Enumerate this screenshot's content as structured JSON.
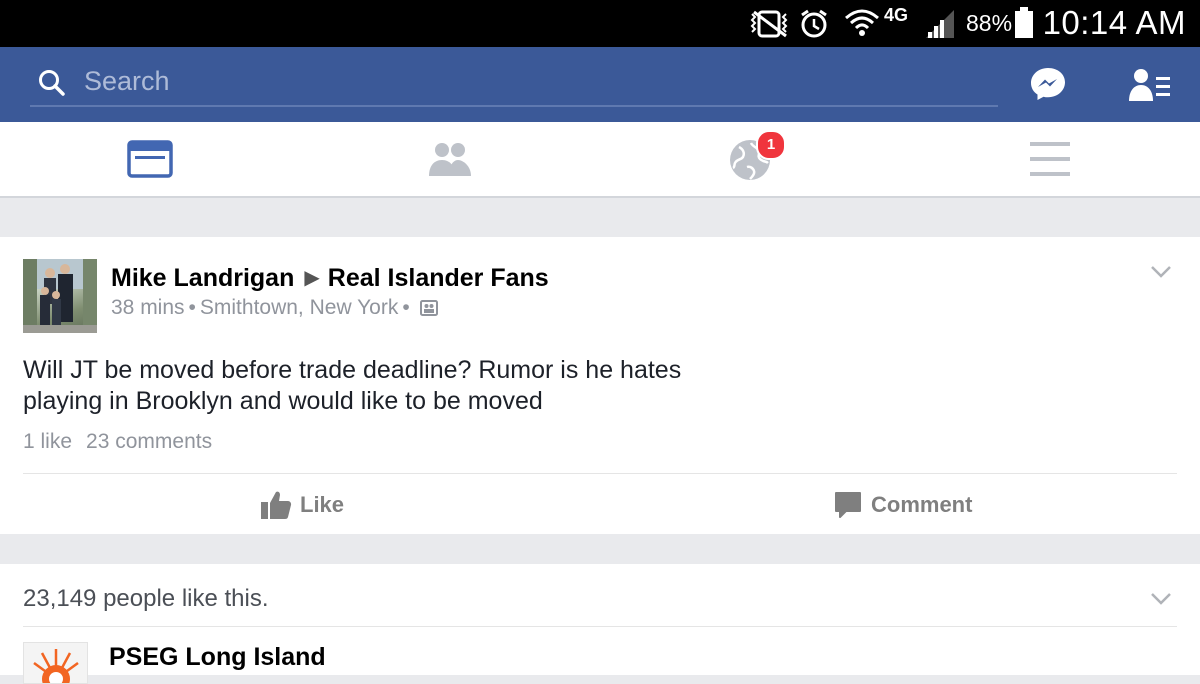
{
  "status_bar": {
    "battery_percent": "88%",
    "time": "10:14 AM",
    "network": "4G"
  },
  "header": {
    "search_placeholder": "Search"
  },
  "tabs": [
    {
      "name": "news-feed",
      "active": true
    },
    {
      "name": "friend-requests",
      "active": false
    },
    {
      "name": "notifications",
      "active": false,
      "badge": "1"
    },
    {
      "name": "more-menu",
      "active": false
    }
  ],
  "post": {
    "author": "Mike Landrigan",
    "target_group": "Real Islander Fans",
    "time_ago": "38 mins",
    "location": "Smithtown, New York",
    "privacy_icon": "group-icon",
    "body": "Will JT be moved before trade deadline?  Rumor is he hates playing in Brooklyn and would like to be moved",
    "likes": "1 like",
    "comments": "23 comments",
    "like_label": "Like",
    "comment_label": "Comment"
  },
  "sponsored": {
    "likes_text": "23,149 people like this.",
    "page_name": "PSEG Long Island"
  },
  "colors": {
    "brand_blue": "#3b5998",
    "active_tab": "#4267b2",
    "inactive_icon": "#bec2c9",
    "badge_red": "#f0353d",
    "feed_bg": "#e9eaed"
  }
}
